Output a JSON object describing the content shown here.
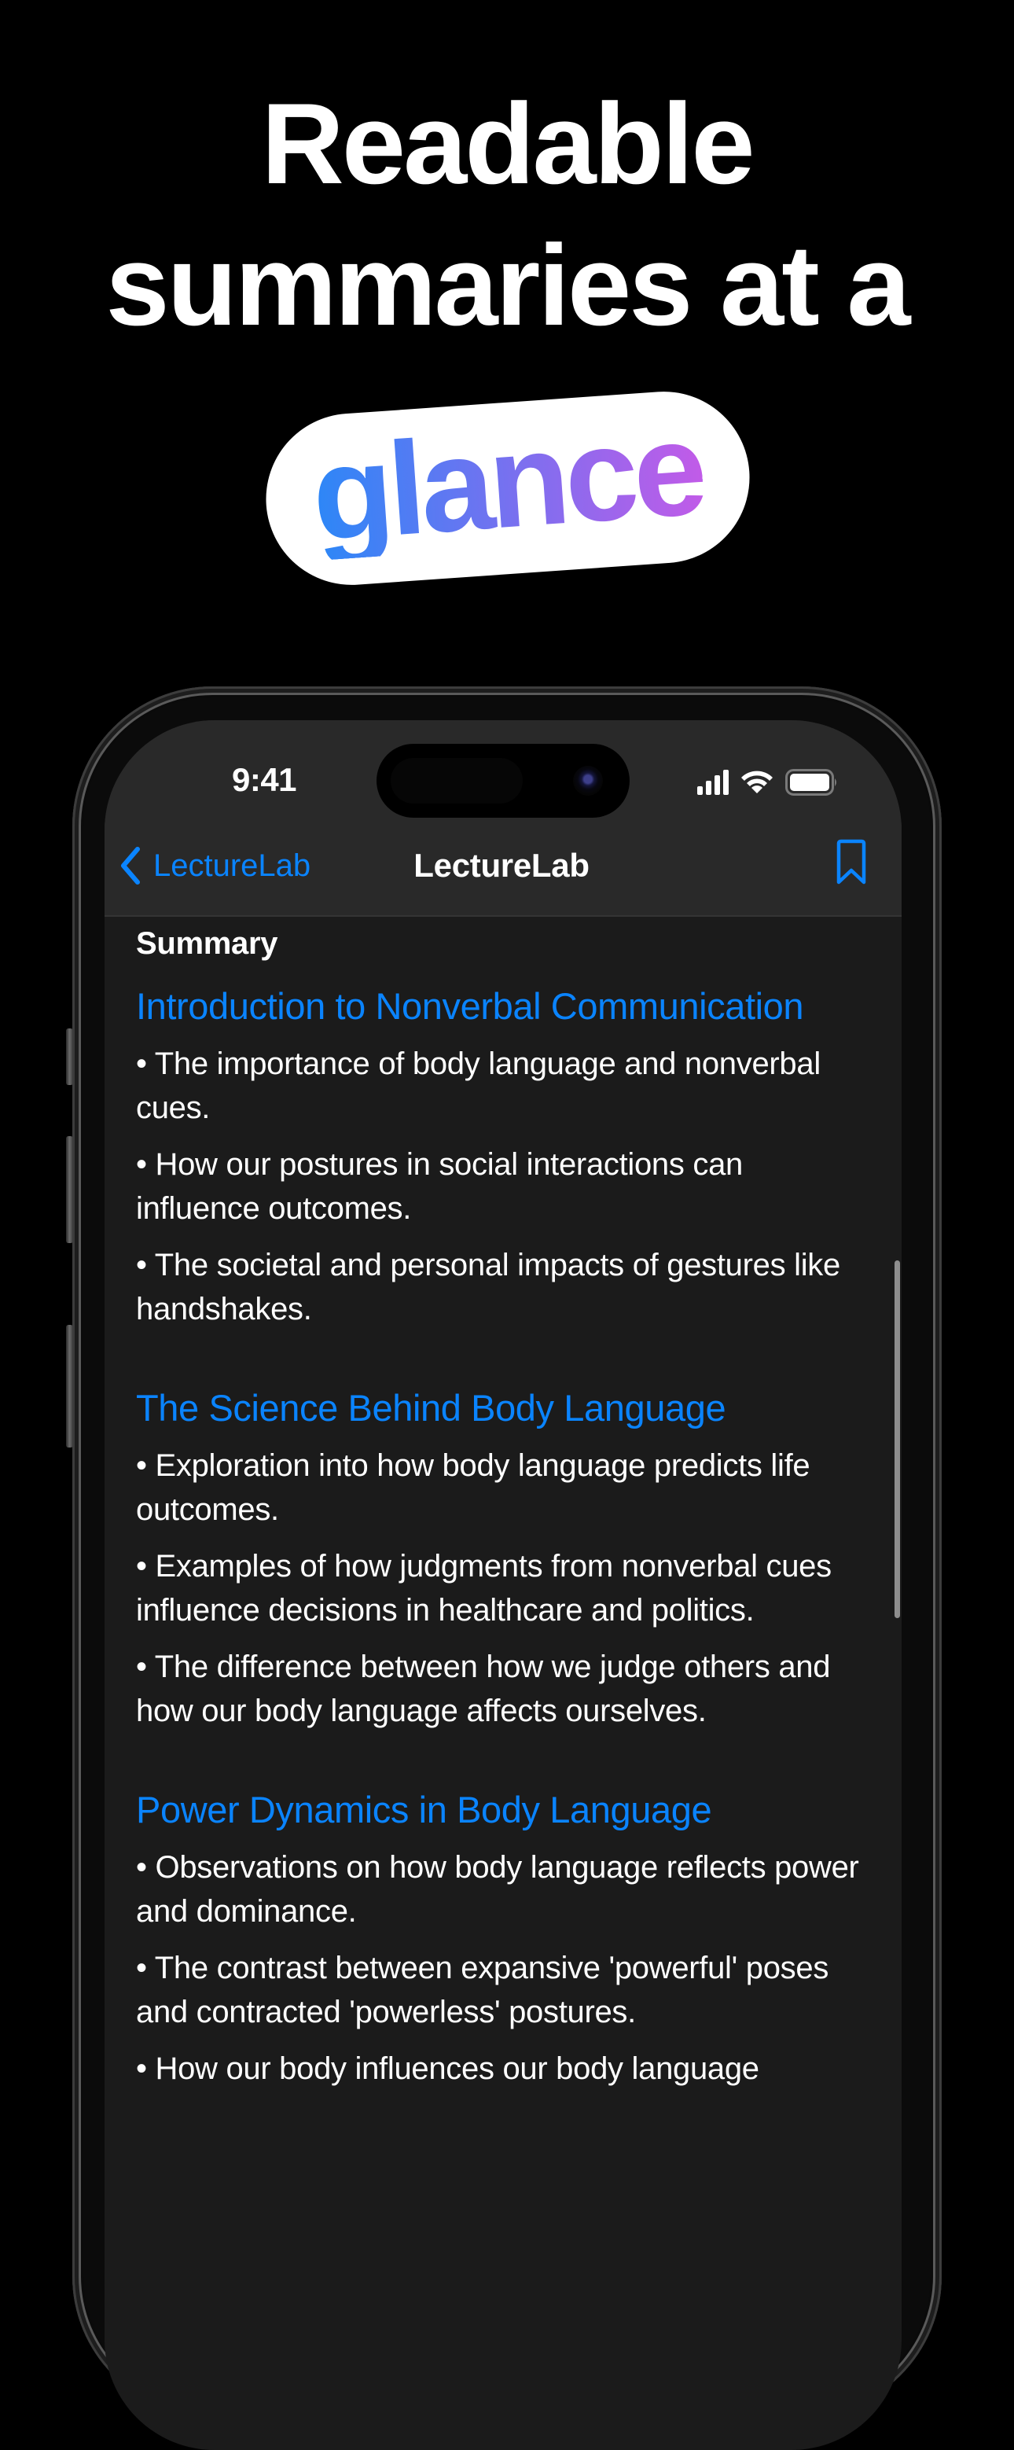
{
  "headline": {
    "line1": "Readable",
    "line2": "summaries at a",
    "highlight": "glance",
    "highlight_gradient": [
      "#2C87F7",
      "#C15BE8"
    ]
  },
  "status_bar": {
    "time": "9:41",
    "icons": [
      "cellular-signal-icon",
      "wifi-icon",
      "battery-icon"
    ]
  },
  "nav": {
    "back_label": "LectureLab",
    "title": "LectureLab",
    "back_icon": "chevron-left-icon",
    "action_icon": "bookmark-icon",
    "accent": "#0A84FF"
  },
  "content": {
    "summary_title": "Summary",
    "sections": [
      {
        "title": "Introduction to Nonverbal Communication",
        "bullets": [
          "• The importance of body language and nonverbal cues.",
          "• How our postures in social interactions can influence outcomes.",
          "• The societal and personal impacts of gestures like handshakes."
        ]
      },
      {
        "title": "The Science Behind Body Language",
        "bullets": [
          "• Exploration into how body language predicts life outcomes.",
          "• Examples of how judgments from nonverbal cues influence decisions in healthcare and politics.",
          "• The difference between how we judge others and how our body language affects ourselves."
        ]
      },
      {
        "title": "Power Dynamics in Body Language",
        "bullets": [
          "• Observations on how body language reflects power and dominance.",
          "• The contrast between expansive 'powerful' poses and contracted 'powerless' postures.",
          "• How our body influences our body language"
        ]
      }
    ]
  }
}
